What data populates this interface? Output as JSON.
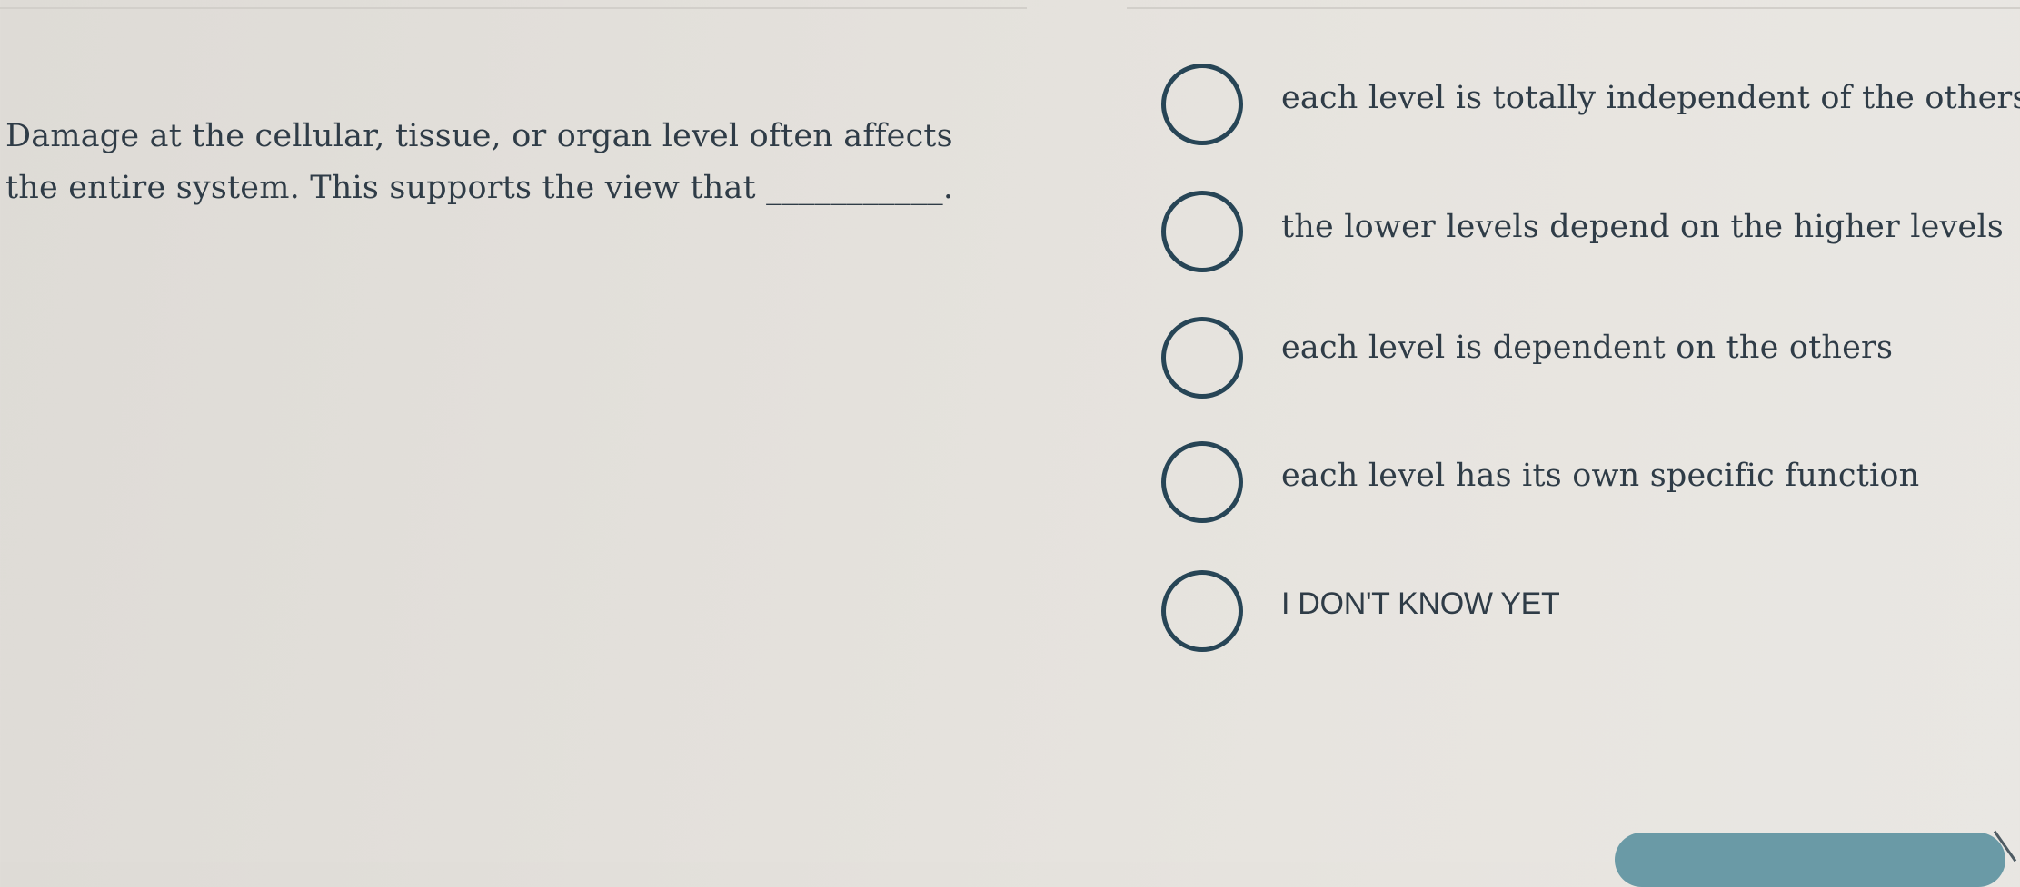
{
  "question": {
    "text": "Damage at the cellular, tissue, or organ level often affects the entire system. This supports the view that ___________."
  },
  "options": [
    {
      "label": "each level is totally independent of the others"
    },
    {
      "label": "the lower levels depend on the higher levels"
    },
    {
      "label": "each level is dependent on the others"
    },
    {
      "label": "each level has its own specific function"
    },
    {
      "label": "I DON'T KNOW YET"
    }
  ],
  "colors": {
    "radio_border": "#274556",
    "text": "#2f3c47",
    "background": "#e3e0db",
    "submit_button": "#6a9aa6"
  }
}
